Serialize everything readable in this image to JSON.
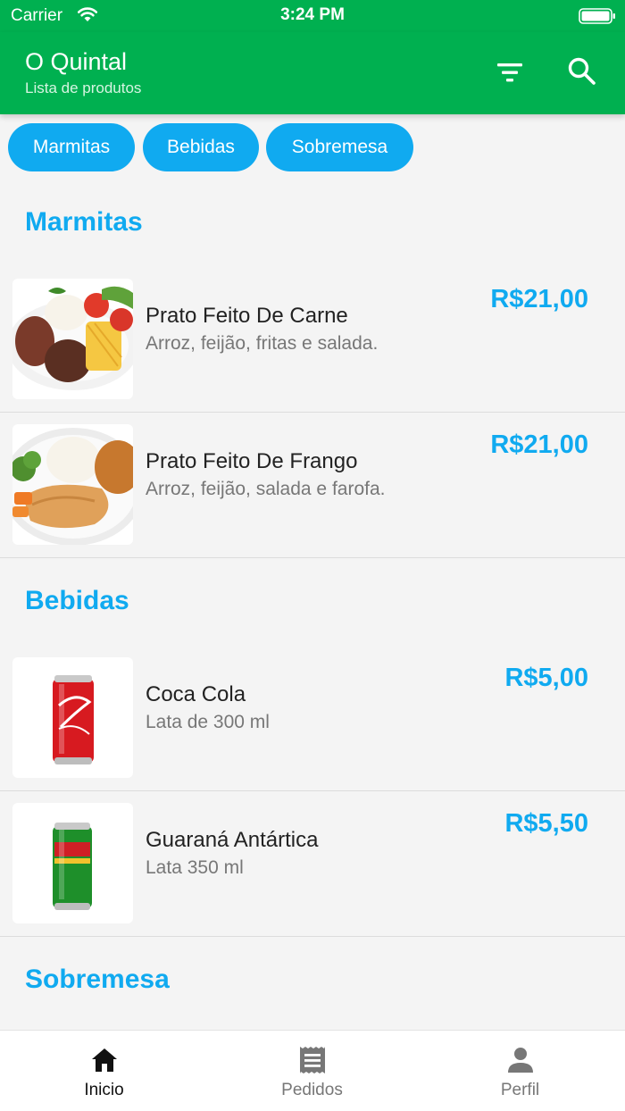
{
  "status_bar": {
    "carrier": "Carrier",
    "time": "3:24 PM"
  },
  "header": {
    "title": "O Quintal",
    "subtitle": "Lista de produtos"
  },
  "categories": [
    "Marmitas",
    "Bebidas",
    "Sobremesa"
  ],
  "sections": [
    {
      "title": "Marmitas",
      "items": [
        {
          "name": "Prato Feito De Carne",
          "description": "Arroz, feijão, fritas e salada.",
          "price": "R$21,00"
        },
        {
          "name": "Prato Feito De Frango",
          "description": "Arroz, feijão, salada e farofa.",
          "price": "R$21,00"
        }
      ]
    },
    {
      "title": "Bebidas",
      "items": [
        {
          "name": "Coca Cola",
          "description": "Lata de 300 ml",
          "price": "R$5,00"
        },
        {
          "name": "Guaraná Antártica",
          "description": "Lata 350 ml",
          "price": "R$5,50"
        }
      ]
    },
    {
      "title": "Sobremesa",
      "items": []
    }
  ],
  "tabs": [
    {
      "label": "Inicio",
      "icon": "home-icon",
      "active": true
    },
    {
      "label": "Pedidos",
      "icon": "receipt-icon",
      "active": false
    },
    {
      "label": "Perfil",
      "icon": "person-icon",
      "active": false
    }
  ],
  "colors": {
    "header": "#00b050",
    "accent": "#10aaf0",
    "tab_active": "#111111",
    "tab_inactive": "#777777"
  }
}
